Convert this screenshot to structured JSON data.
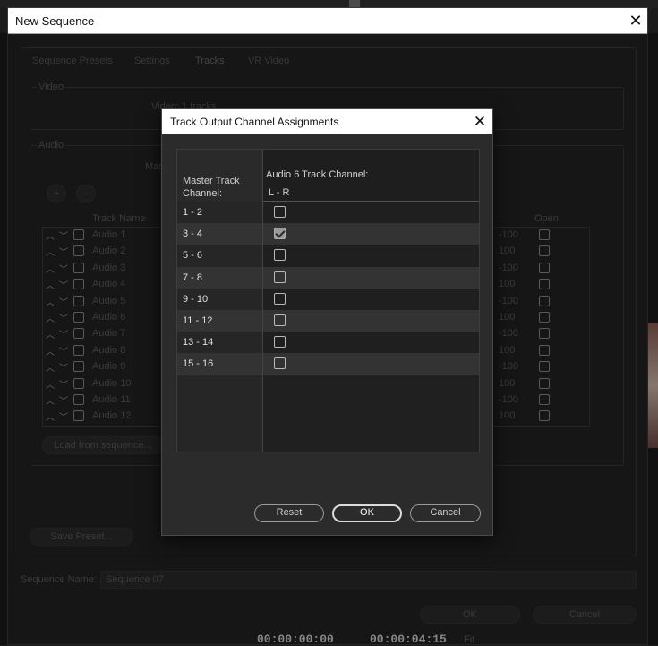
{
  "outer_dialog": {
    "title": "New Sequence",
    "tabs": [
      "Sequence Presets",
      "Settings",
      "Tracks",
      "VR Video"
    ],
    "video_group_label": "Video",
    "video_tracks_text": "Video: 1 tracks",
    "audio_group_label": "Audio",
    "audio_master_label": "Mas",
    "add_button": "+",
    "remove_button": "-",
    "column_track_name": "Track Name",
    "column_open": "Open",
    "tracks": [
      {
        "name": "Audio 1",
        "pan": "-100"
      },
      {
        "name": "Audio 2",
        "pan": "100"
      },
      {
        "name": "Audio 3",
        "pan": "-100"
      },
      {
        "name": "Audio 4",
        "pan": "100"
      },
      {
        "name": "Audio 5",
        "pan": "-100"
      },
      {
        "name": "Audio 6",
        "pan": "100"
      },
      {
        "name": "Audio 7",
        "pan": "-100"
      },
      {
        "name": "Audio 8",
        "pan": "100"
      },
      {
        "name": "Audio 9",
        "pan": "-100"
      },
      {
        "name": "Audio 10",
        "pan": "100"
      },
      {
        "name": "Audio 11",
        "pan": "-100"
      },
      {
        "name": "Audio 12",
        "pan": "100"
      }
    ],
    "load_from_sequence": "Load from sequence...",
    "save_preset": "Save Preset...",
    "sequence_name_label": "Sequence Name:",
    "sequence_name_value": "Sequence 07",
    "ok": "OK",
    "cancel": "Cancel"
  },
  "dialog": {
    "title": "Track Output Channel Assignments",
    "col1_header": "Master Track Channel:",
    "col2_header": "Audio 6 Track Channel:",
    "col2_sub": "L - R",
    "rows": [
      {
        "label": "1 - 2",
        "checked": false
      },
      {
        "label": "3 - 4",
        "checked": true
      },
      {
        "label": "5 - 6",
        "checked": false
      },
      {
        "label": "7 - 8",
        "checked": false
      },
      {
        "label": "9 - 10",
        "checked": false
      },
      {
        "label": "11 - 12",
        "checked": false
      },
      {
        "label": "13 - 14",
        "checked": false
      },
      {
        "label": "15 - 16",
        "checked": false
      }
    ],
    "reset": "Reset",
    "ok": "OK",
    "cancel": "Cancel"
  },
  "timeline": {
    "timecode_start": "00:00:00:00",
    "timecode_end": "00:00:04:15",
    "zoom": "Fit"
  }
}
